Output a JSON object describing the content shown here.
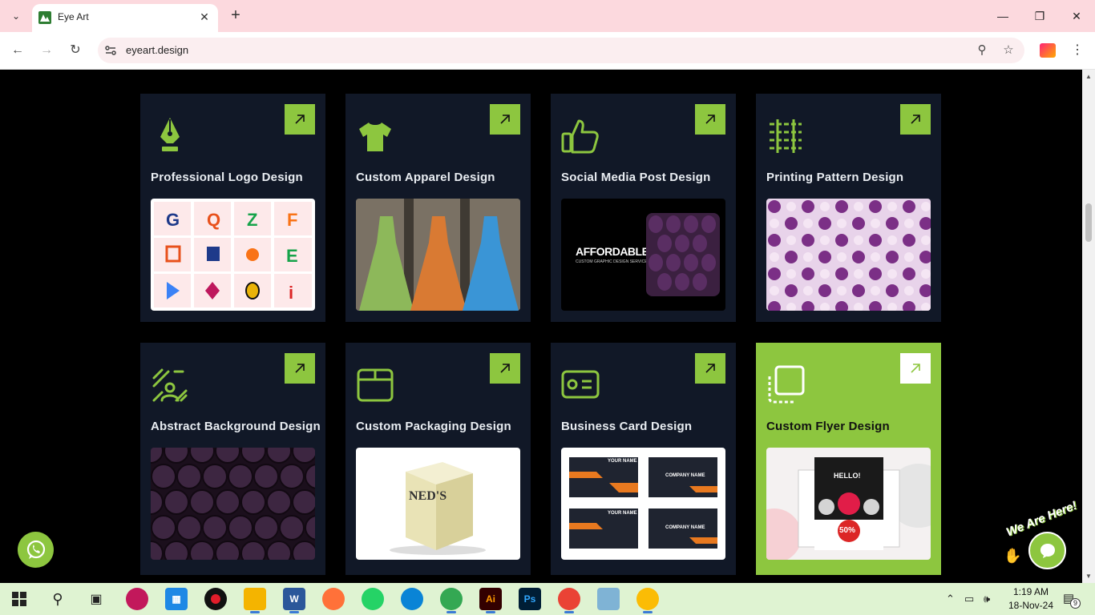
{
  "browser": {
    "tab_title": "Eye Art",
    "url": "eyeart.design",
    "new_tab": "+",
    "tab_close": "✕"
  },
  "services": [
    {
      "title": "Professional Logo Design",
      "icon": "pen-nib-icon",
      "image": "logo-grid"
    },
    {
      "title": "Custom Apparel Design",
      "icon": "tshirt-icon",
      "image": "dresses"
    },
    {
      "title": "Social Media Post Design",
      "icon": "thumbs-up-icon",
      "image": "affordable"
    },
    {
      "title": "Printing Pattern Design",
      "icon": "pattern-grid-icon",
      "image": "purple-pattern"
    },
    {
      "title": "Abstract Background Design",
      "icon": "abstract-lines-icon",
      "image": "circles-bg"
    },
    {
      "title": "Custom Packaging Design",
      "icon": "box-icon",
      "image": "neds-box"
    },
    {
      "title": "Business Card Design",
      "icon": "id-card-icon",
      "image": "business-cards"
    },
    {
      "title": "Custom Flyer Design",
      "icon": "flyer-icon",
      "image": "flyers"
    }
  ],
  "social_image_text": {
    "headline": "AFFORDABLE",
    "sub": "CUSTOM GRAPHIC DESIGN SERVICES"
  },
  "box_text": "NED'S",
  "cards_text": {
    "name": "YOUR NAME",
    "company": "COMPANY NAME"
  },
  "flyer_text": {
    "hello": "HELLO!",
    "discount": "50%"
  },
  "chat_widget": {
    "label": "We Are Here!"
  },
  "taskbar": {
    "time": "1:19 AM",
    "date": "18-Nov-24",
    "notifications": "9"
  },
  "colors": {
    "accent": "#8dc63f",
    "card_bg": "#111827",
    "tabbar": "#fcd9de",
    "taskbar": "#dff3d2"
  }
}
